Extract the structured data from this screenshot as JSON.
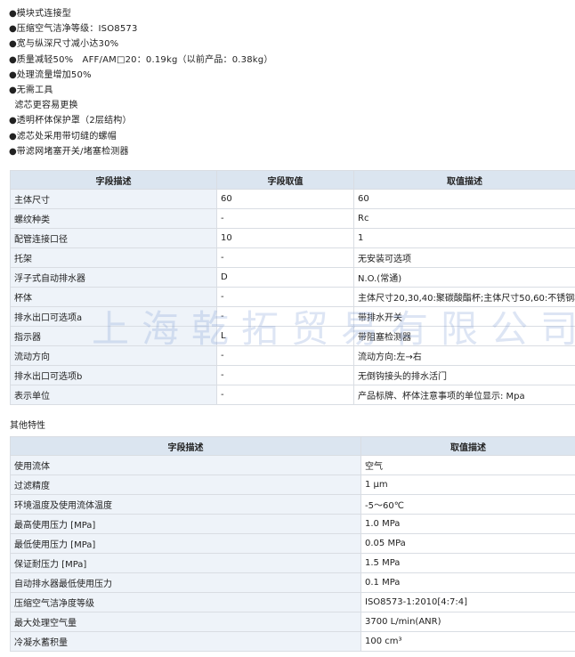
{
  "features": [
    "模块式连接型",
    "压缩空气洁净等级：ISO8573",
    "宽与纵深尺寸减小达30%",
    "质量减轻50%　AFF/AM□20：0.19kg（以前产品：0.38kg）",
    "处理流量增加50%",
    "无需工具",
    "滤芯更容易更换",
    "透明杯体保护罩（2层结构）",
    "滤芯处采用带切缝的螺帽",
    "带滤网堵塞开关/堵塞检测器"
  ],
  "table1": {
    "headers": [
      "字段描述",
      "字段取值",
      "取值描述"
    ],
    "rows": [
      [
        "主体尺寸",
        "60",
        "60"
      ],
      [
        "螺纹种类",
        "-",
        "Rc"
      ],
      [
        "配管连接口径",
        "10",
        "1"
      ],
      [
        "托架",
        "-",
        "无安装可选项"
      ],
      [
        "浮子式自动排水器",
        "D",
        "N.O.(常通)"
      ],
      [
        "杯体",
        "-",
        "主体尺寸20,30,40:聚碳酸酯杯;主体尺寸50,60:不锈钢杯"
      ],
      [
        "排水出口可选项a",
        "-",
        "带排水开关"
      ],
      [
        "指示器",
        "L",
        "带阻塞检测器"
      ],
      [
        "流动方向",
        "-",
        "流动方向:左→右"
      ],
      [
        "排水出口可选项b",
        "-",
        "无倒钩接头的排水活门"
      ],
      [
        "表示单位",
        "-",
        "产品标牌、杯体注意事项的单位显示: Mpa"
      ]
    ]
  },
  "section_title": "其他特性",
  "table2": {
    "headers": [
      "字段描述",
      "取值描述"
    ],
    "rows": [
      [
        "使用流体",
        "空气"
      ],
      [
        "过滤精度",
        "1 μm"
      ],
      [
        "环境温度及使用流体温度",
        "-5～60℃"
      ],
      [
        "最高使用压力 [MPa]",
        "1.0 MPa"
      ],
      [
        "最低使用压力 [MPa]",
        "0.05 MPa"
      ],
      [
        "保证耐压力 [MPa]",
        "1.5 MPa"
      ],
      [
        "自动排水器最低使用压力",
        "0.1 MPa"
      ],
      [
        "压缩空气洁净度等级",
        "ISO8573-1:2010[4:7:4]"
      ],
      [
        "最大处理空气量",
        "3700 L/min(ANR)"
      ],
      [
        "冷凝水蓄积量",
        "100 cm³"
      ]
    ]
  },
  "watermark": "上海乾拓贸易有限公司"
}
